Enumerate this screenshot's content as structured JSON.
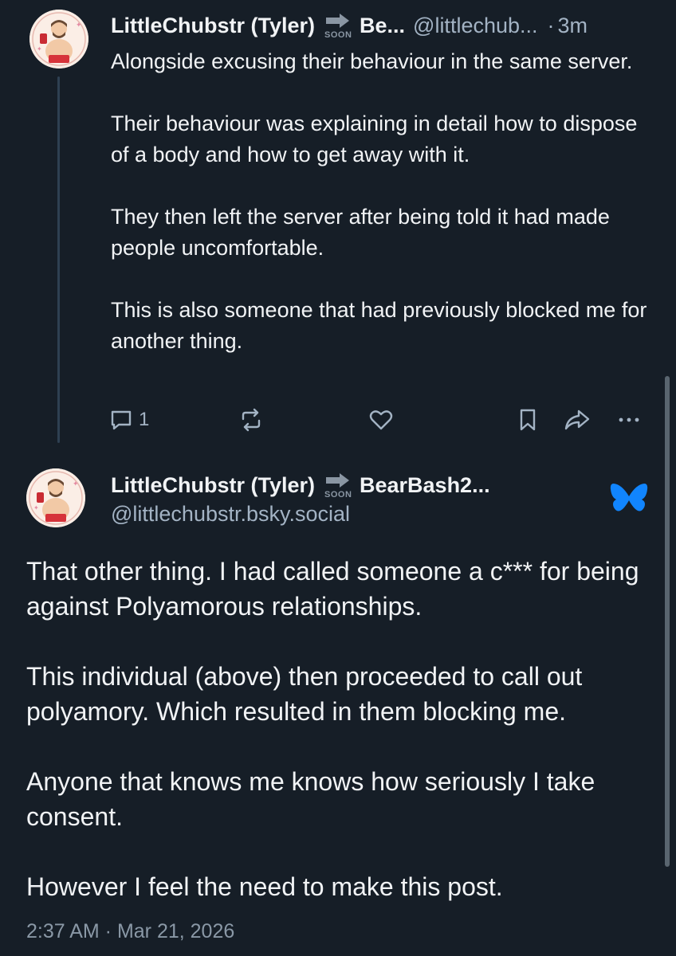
{
  "post1": {
    "author_name": "LittleChubstr (Tyler)",
    "soon_label": "SOON",
    "name_suffix": "Be...",
    "handle": "@littlechub...",
    "separator": "·",
    "time": "3m",
    "paragraphs": [
      "Alongside excusing their behaviour in the same server.",
      "Their behaviour was explaining in detail how to dispose of a body and how to get away with it.",
      "They then left the server after being told it had made people uncomfortable.",
      "This is also someone that had previously blocked me for another thing."
    ],
    "actions": {
      "reply_count": "1",
      "icons": [
        "reply-icon",
        "repost-icon",
        "like-icon",
        "bookmark-icon",
        "share-icon",
        "more-icon"
      ]
    }
  },
  "post2": {
    "author_name": "LittleChubstr (Tyler)",
    "soon_label": "SOON",
    "name_suffix": "BearBash2...",
    "handle": "@littlechubstr.bsky.social",
    "paragraphs": [
      "That other thing. I had called someone a c*** for being against Polyamorous relationships.",
      "This individual (above) then proceeded to call out polyamory. Which resulted in them blocking me.",
      "Anyone that knows me knows how seriously I take consent.",
      "However I feel the need to make this post."
    ],
    "timestamp": "2:37 AM · Mar 21, 2026"
  },
  "colors": {
    "background": "#161e27",
    "text": "#f1f3f5",
    "muted": "#a3b3c4",
    "bluesky": "#1185fe"
  }
}
